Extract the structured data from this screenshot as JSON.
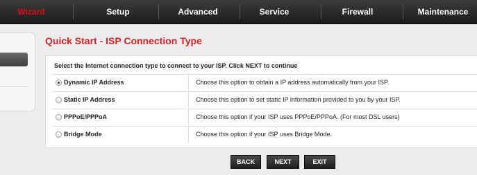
{
  "nav": {
    "items": [
      {
        "label": "Wizard",
        "active": true
      },
      {
        "label": "Setup",
        "active": false
      },
      {
        "label": "Advanced",
        "active": false
      },
      {
        "label": "Service",
        "active": false
      },
      {
        "label": "Firewall",
        "active": false
      },
      {
        "label": "Maintenance",
        "active": false
      }
    ]
  },
  "page": {
    "title": "Quick Start - ISP Connection Type",
    "instruction": "Select the Internet connection type to connect to your ISP. Click NEXT to continue"
  },
  "options": [
    {
      "label": "Dynamic IP Address",
      "description": "Choose this option to obtain a IP address automatically from your ISP.",
      "selected": true
    },
    {
      "label": "Static IP Address",
      "description": "Choose this option to set static IP information provided to you by your ISP.",
      "selected": false
    },
    {
      "label": "PPPoE/PPPoA",
      "description": "Choose this option if your ISP uses PPPoE/PPPoA. (For most DSL users)",
      "selected": false
    },
    {
      "label": "Bridge Mode",
      "description": "Choose this option if your ISP uses Bridge Mode.",
      "selected": false
    }
  ],
  "buttons": {
    "back": "BACK",
    "next": "NEXT",
    "exit": "EXIT"
  },
  "colors": {
    "accent": "#d2232a",
    "nav_active": "#e10a16",
    "nav_bg": "#2a2a2a"
  }
}
